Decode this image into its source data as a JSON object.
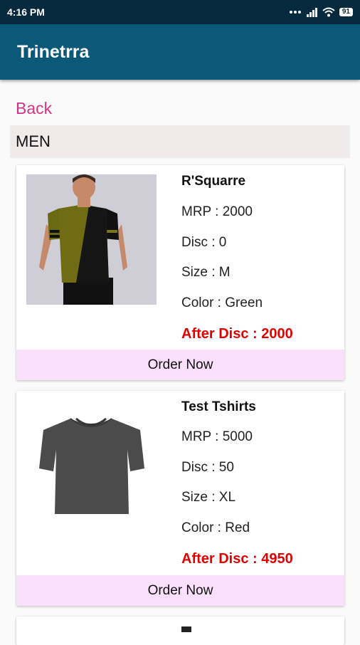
{
  "status_bar": {
    "time": "4:16 PM",
    "battery": "91"
  },
  "app_bar": {
    "title": "Trinetrra"
  },
  "nav": {
    "back_label": "Back"
  },
  "category": {
    "title": "MEN"
  },
  "products": [
    {
      "name": "R'Squarre",
      "mrp": "MRP : 2000",
      "disc": "Disc : 0",
      "size": "Size : M",
      "color": "Color : Green",
      "after_disc": "After Disc : 2000",
      "order_label": "Order Now"
    },
    {
      "name": "Test Tshirts",
      "mrp": "MRP : 5000",
      "disc": "Disc : 50",
      "size": "Size : XL",
      "color": "Color : Red",
      "after_disc": "After Disc : 4950",
      "order_label": "Order Now"
    }
  ],
  "colors": {
    "status_bar": "#052a3d",
    "app_bar": "#0b5878",
    "back_link": "#d63384",
    "category_bg": "#f1eaea",
    "after_disc": "#e00000",
    "order_bg": "#fbe0fb"
  }
}
